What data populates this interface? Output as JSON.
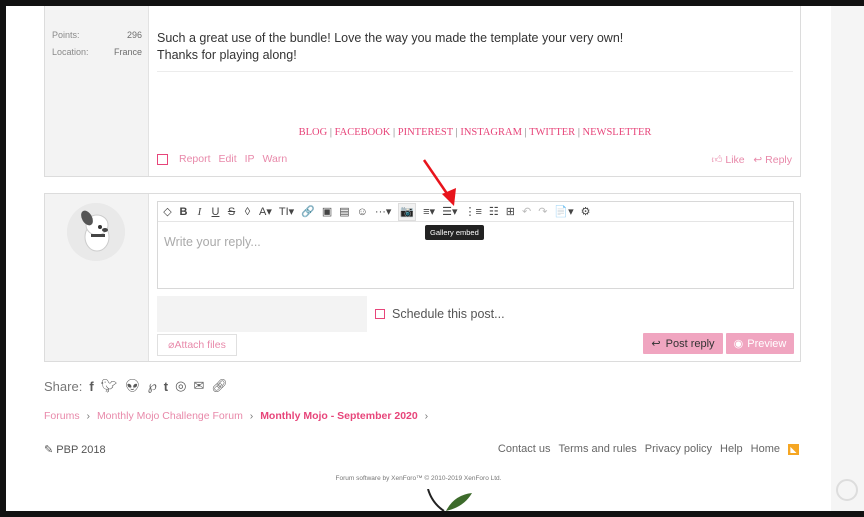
{
  "post": {
    "stats": [
      {
        "label": "Points:",
        "value": "296"
      },
      {
        "label": "Location:",
        "value": "France"
      }
    ],
    "message_lines": [
      "Such a great use of the bundle! Love the way you made the template your very own!",
      "Thanks for playing along!"
    ],
    "signature_links": [
      "BLOG",
      "FACEBOOK",
      "PINTEREST",
      "INSTAGRAM",
      "TWITTER",
      "NEWSLETTER"
    ],
    "signature_sep": "|",
    "actions": [
      "Report",
      "Edit",
      "IP",
      "Warn"
    ],
    "like_label": "Like",
    "reply_label": "Reply"
  },
  "editor": {
    "toolbar": [
      "◇",
      "B",
      "I",
      "U",
      "S",
      "◊",
      "A▾",
      "TI▾",
      "🔗",
      "▣",
      "▤",
      "☺",
      "···▾",
      "📷",
      "≡▾",
      "☰▾",
      "⋮≡",
      "☷",
      "⊞",
      "↶",
      "↷",
      "📄▾",
      "⚙"
    ],
    "placeholder": "Write your reply...",
    "tooltip": "Gallery embed",
    "schedule_label": "Schedule this post...",
    "attach_label": "Attach files",
    "post_reply_label": "Post reply",
    "preview_label": "Preview"
  },
  "share": {
    "label": "Share:",
    "icons": [
      "facebook-icon",
      "twitter-icon",
      "reddit-icon",
      "pinterest-icon",
      "tumblr-icon",
      "whatsapp-icon",
      "email-icon",
      "link-icon"
    ]
  },
  "breadcrumb": {
    "items": [
      "Forums",
      "Monthly Mojo Challenge Forum"
    ],
    "current": "Monthly Mojo - September 2020"
  },
  "footer": {
    "style_label": "PBP 2018",
    "links": [
      "Contact us",
      "Terms and rules",
      "Privacy policy",
      "Help",
      "Home"
    ],
    "copyright": "Forum software by XenForo™ © 2010-2019 XenForo Ltd."
  },
  "colors": {
    "accent": "#e7457a",
    "button": "#f0a5c0",
    "arrow": "#e8141c"
  }
}
